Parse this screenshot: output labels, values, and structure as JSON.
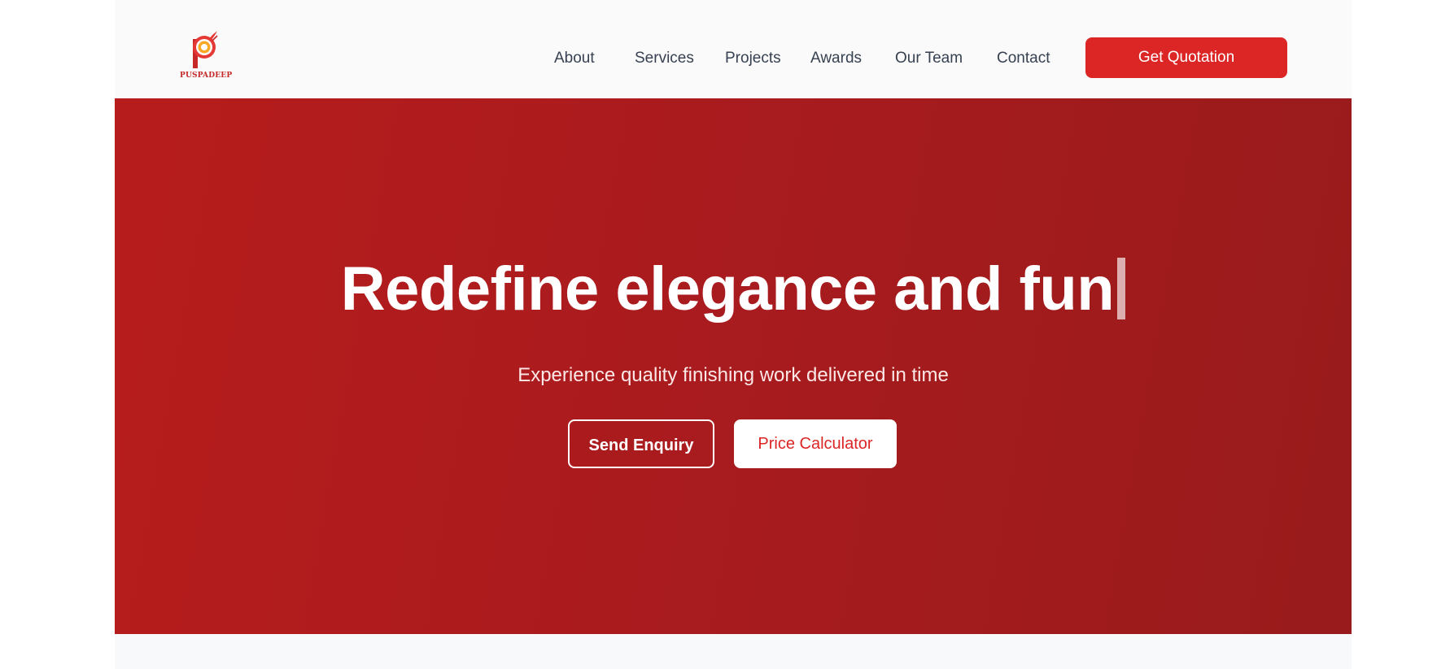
{
  "brand": {
    "name": "PUSPADEEP",
    "primary_color": "#dc2626",
    "hero_color": "#b71c1c"
  },
  "nav": {
    "items": [
      "About",
      "Services",
      "Projects",
      "Awards",
      "Our Team",
      "Contact"
    ],
    "cta_label": "Get Quotation"
  },
  "hero": {
    "title": "Redefine elegance and fun",
    "subtitle": "Experience quality finishing work delivered in time",
    "primary_button": "Send Enquiry",
    "secondary_button": "Price Calculator"
  }
}
